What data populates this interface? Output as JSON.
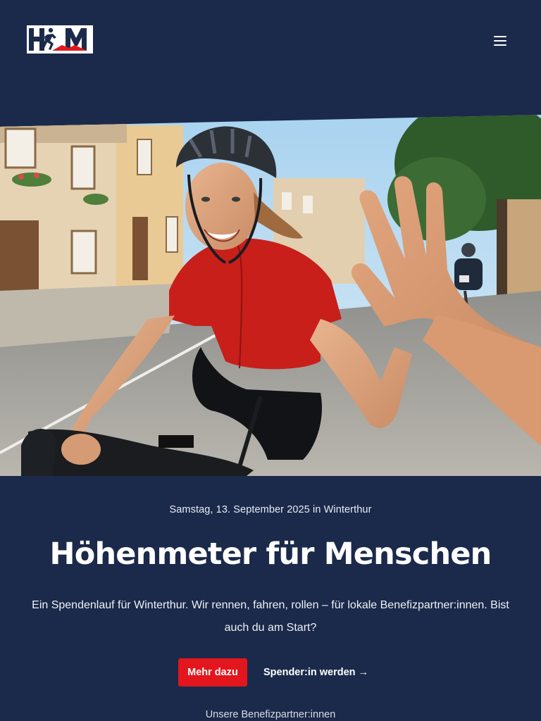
{
  "header": {
    "logo_text": "HFM",
    "menu_icon": "hamburger-menu-icon"
  },
  "hero": {
    "image_description_icon": "cyclist-high-five-photo"
  },
  "event": {
    "date": "Samstag, 13. September 2025 in Winterthur",
    "title": "Höhenmeter für Menschen",
    "intro": "Ein Spendenlauf für Winterthur. Wir rennen, fahren, rollen – für lokale Benefizpartner:innen. Bist auch du am Start?"
  },
  "cta": {
    "primary_label": "Mehr dazu",
    "secondary_label": "Spender:in werden →"
  },
  "partners": {
    "label": "Unsere Benefizpartner:innen"
  },
  "colors": {
    "background": "#1b2a4a",
    "accent": "#e3161e",
    "text": "#ffffff"
  }
}
